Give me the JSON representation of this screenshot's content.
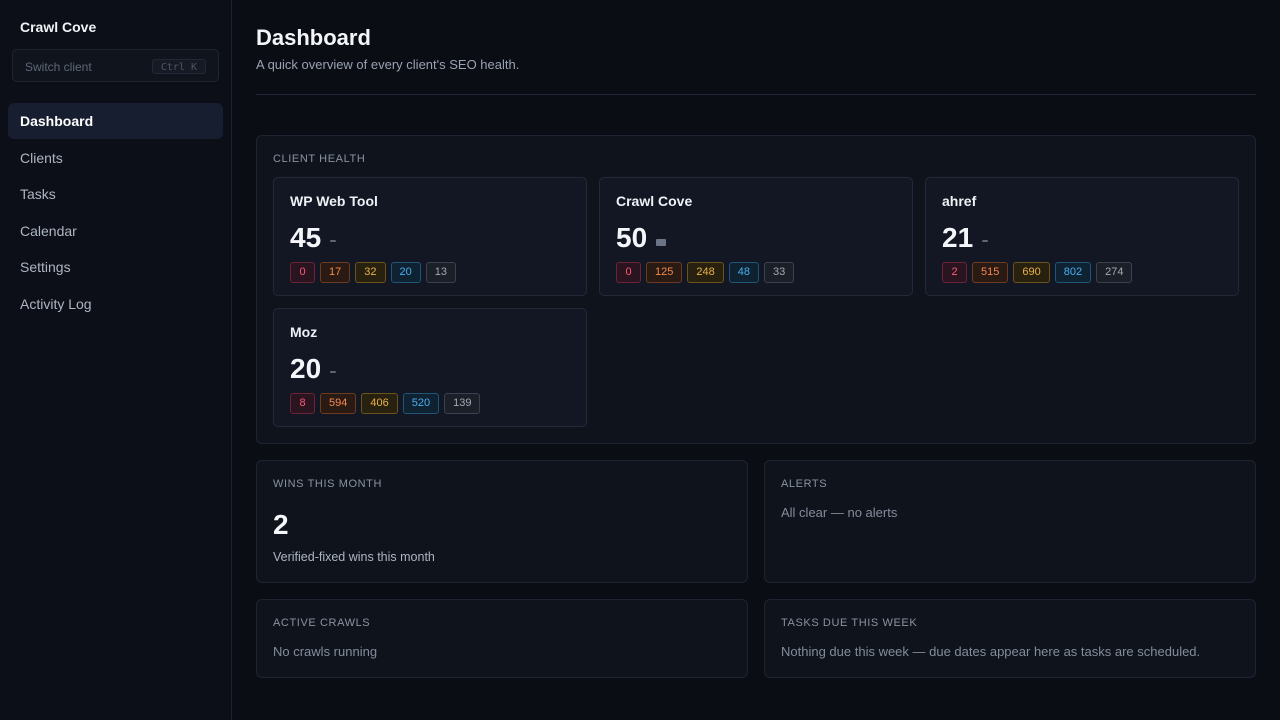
{
  "sidebar": {
    "brand": "Crawl Cove",
    "switch_placeholder": "Switch client",
    "switch_shortcut": "Ctrl K",
    "items": [
      {
        "label": "Dashboard",
        "active": true
      },
      {
        "label": "Clients"
      },
      {
        "label": "Tasks"
      },
      {
        "label": "Calendar"
      },
      {
        "label": "Settings"
      },
      {
        "label": "Activity Log"
      }
    ]
  },
  "header": {
    "title": "Dashboard",
    "subtitle": "A quick overview of every client's SEO health."
  },
  "client_health": {
    "label": "CLIENT HEALTH",
    "clients": [
      {
        "name": "WP Web Tool",
        "score": "45",
        "badges": [
          "0",
          "17",
          "32",
          "20",
          "13"
        ]
      },
      {
        "name": "Crawl Cove",
        "score": "50",
        "badges": [
          "0",
          "125",
          "248",
          "48",
          "33"
        ]
      },
      {
        "name": "ahref",
        "score": "21",
        "badges": [
          "2",
          "515",
          "690",
          "802",
          "274"
        ]
      },
      {
        "name": "Moz",
        "score": "20",
        "badges": [
          "8",
          "594",
          "406",
          "520",
          "139"
        ]
      }
    ]
  },
  "wins": {
    "label": "WINS THIS MONTH",
    "value": "2",
    "caption": "Verified-fixed wins this month"
  },
  "alerts": {
    "label": "ALERTS",
    "text": "All clear — no alerts"
  },
  "crawls": {
    "label": "ACTIVE CRAWLS",
    "text": "No crawls running"
  },
  "tasks_due": {
    "label": "TASKS DUE THIS WEEK",
    "text": "Nothing due this week — due dates appear here as tasks are scheduled."
  },
  "colors": {
    "background": "#0a0d14",
    "critical": "#ff5a72",
    "high": "#f38a4c",
    "medium": "#e8b248",
    "info": "#4aaef0",
    "muted": "#a2a9b5"
  }
}
